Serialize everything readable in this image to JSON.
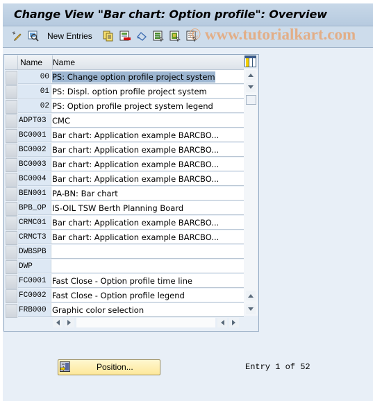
{
  "window": {
    "title": "Change View \"Bar chart: Option profile\": Overview"
  },
  "toolbar": {
    "items": [
      {
        "icon": "display-change-icon"
      },
      {
        "icon": "find-icon"
      },
      {
        "label": "New Entries"
      },
      {
        "icon": "copy-as-icon"
      },
      {
        "icon": "delete-icon"
      },
      {
        "icon": "undo-change-icon"
      },
      {
        "icon": "select-all-icon"
      },
      {
        "icon": "select-block-icon"
      },
      {
        "icon": "deselect-all-icon"
      }
    ],
    "new_entries_label": "New Entries",
    "watermark": "© www.tutorialkart.com"
  },
  "table": {
    "columns": [
      "Name",
      "Name"
    ],
    "rows": [
      {
        "key": "00",
        "name": "PS: Change option profile project system",
        "selected": true
      },
      {
        "key": "01",
        "name": "PS: Displ. option profile project system"
      },
      {
        "key": "02",
        "name": "PS: Option profile project system legend"
      },
      {
        "key": "ADPT03",
        "name": "CMC"
      },
      {
        "key": "BC0001",
        "name": "Bar chart: Application example BARCBO..."
      },
      {
        "key": "BC0002",
        "name": "Bar chart: Application example BARCBO..."
      },
      {
        "key": "BC0003",
        "name": "Bar chart: Application example BARCBO..."
      },
      {
        "key": "BC0004",
        "name": "Bar chart: Application example BARCBO..."
      },
      {
        "key": "BEN001",
        "name": "PA-BN: Bar chart"
      },
      {
        "key": "BPB_OP",
        "name": "IS-OIL TSW Berth Planning Board"
      },
      {
        "key": "CRMC01",
        "name": "Bar chart: Application example BARCBO..."
      },
      {
        "key": "CRMCT3",
        "name": "Bar chart: Application example BARCBO..."
      },
      {
        "key": "DWBSPB",
        "name": ""
      },
      {
        "key": "DWP",
        "name": ""
      },
      {
        "key": "FC0001",
        "name": "Fast Close - Option profile time line"
      },
      {
        "key": "FC0002",
        "name": "Fast Close - Option profile legend"
      },
      {
        "key": "FRB000",
        "name": "Graphic color selection"
      }
    ]
  },
  "footer": {
    "position_button": "Position...",
    "entry_status": "Entry 1 of 52"
  },
  "colors": {
    "title_bar": "#b6cadf",
    "toolbar": "#cddceb",
    "background": "#e8eff7",
    "key_cell": "#dde8f4",
    "selection_highlight": "#9db6d1",
    "position_button": "#fde89a"
  }
}
